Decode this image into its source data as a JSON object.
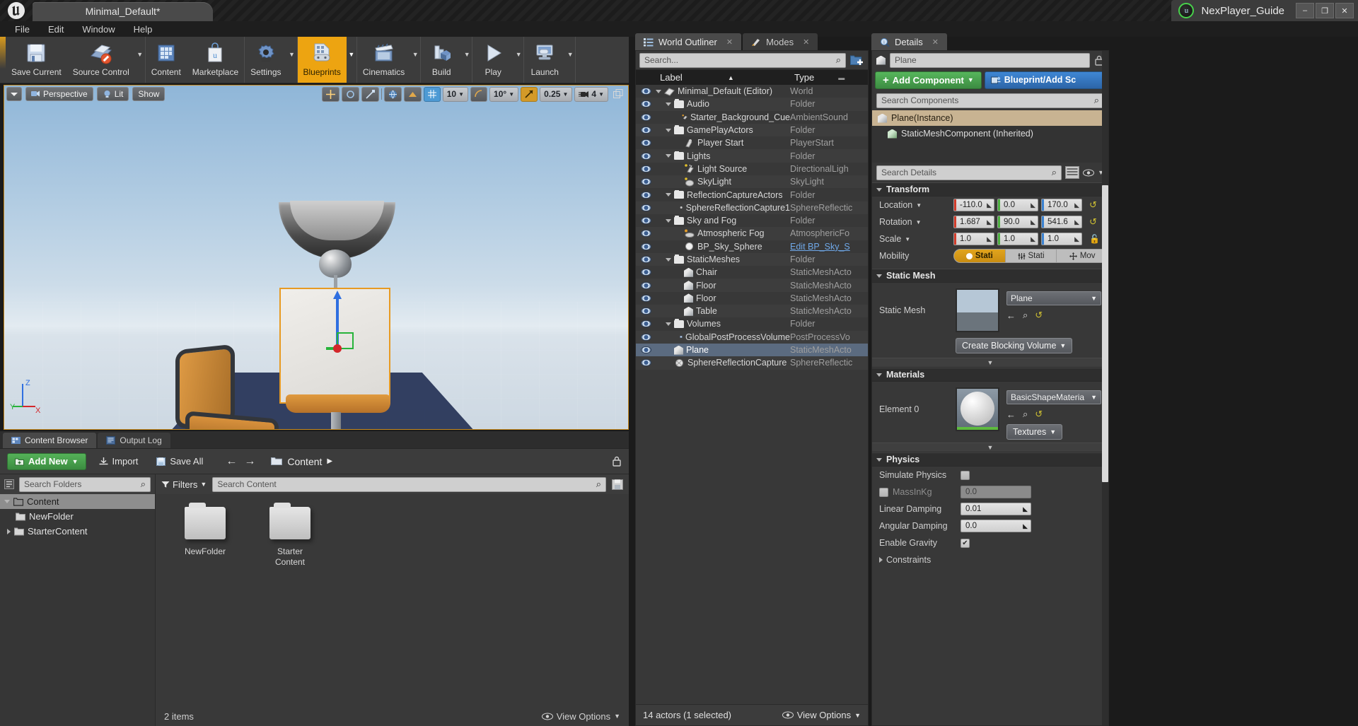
{
  "titlebar": {
    "logo": "unreal-logo",
    "document_tab": "Minimal_Default*",
    "project_name": "NexPlayer_Guide",
    "project_badge": "u",
    "window_buttons": {
      "minimize": "–",
      "maximize": "❐",
      "close": "✕"
    }
  },
  "menubar": {
    "items": [
      "File",
      "Edit",
      "Window",
      "Help"
    ]
  },
  "toolbar": {
    "buttons": [
      {
        "label": "Save Current",
        "icon": "save-icon",
        "caret": false,
        "active": false
      },
      {
        "label": "Source Control",
        "icon": "source-control-icon",
        "caret": true,
        "active": false
      },
      {
        "label": "Content",
        "icon": "content-icon",
        "caret": false,
        "active": false
      },
      {
        "label": "Marketplace",
        "icon": "marketplace-icon",
        "caret": false,
        "active": false
      },
      {
        "label": "Settings",
        "icon": "settings-gear-icon",
        "caret": true,
        "active": false
      },
      {
        "label": "Blueprints",
        "icon": "blueprints-icon",
        "caret": true,
        "active": true
      },
      {
        "label": "Cinematics",
        "icon": "cinematics-clapper-icon",
        "caret": true,
        "active": false
      },
      {
        "label": "Build",
        "icon": "build-icon",
        "caret": true,
        "active": false
      },
      {
        "label": "Play",
        "icon": "play-triangle-icon",
        "caret": true,
        "active": false
      },
      {
        "label": "Launch",
        "icon": "launch-icon",
        "caret": true,
        "active": false
      }
    ]
  },
  "viewport": {
    "left_controls": [
      {
        "label": "",
        "icon": "viewport-menu-icon"
      },
      {
        "label": "Perspective",
        "icon": "camera-icon"
      },
      {
        "label": "Lit",
        "icon": "lighting-icon"
      },
      {
        "label": "Show",
        "icon": ""
      }
    ],
    "right_controls": [
      {
        "name": "transform-translate-icon",
        "kind": "dark"
      },
      {
        "name": "transform-rotate-icon",
        "kind": "dark"
      },
      {
        "name": "transform-scale-icon",
        "kind": "dark"
      },
      {
        "name": "world-coords-icon",
        "kind": "dark"
      },
      {
        "name": "surface-snap-icon",
        "kind": "dark"
      },
      {
        "name": "grid-snap-icon",
        "kind": "grid",
        "value": "10"
      },
      {
        "name": "rotation-snap-icon",
        "kind": "dark",
        "value": "10°"
      },
      {
        "name": "scale-snap-icon",
        "kind": "highlight",
        "value": "0.25"
      },
      {
        "name": "camera-speed-icon",
        "kind": "dark",
        "value": "4"
      },
      {
        "name": "maximize-viewport-icon",
        "kind": "plain"
      }
    ],
    "axis_labels": {
      "x": "X",
      "y": "Y",
      "z": "Z"
    }
  },
  "world_outliner": {
    "tabs": [
      {
        "label": "World Outliner",
        "icon": "outliner-icon",
        "active": true
      },
      {
        "label": "Modes",
        "icon": "modes-icon",
        "active": false
      }
    ],
    "search_placeholder": "Search...",
    "add_icon": "add-folder-icon",
    "columns": {
      "label": "Label",
      "type": "Type"
    },
    "rows": [
      {
        "label": "Minimal_Default (Editor)",
        "type": "World",
        "indent": 0,
        "icon": "world-icon",
        "expander": "down",
        "selected": false
      },
      {
        "label": "Audio",
        "type": "Folder",
        "indent": 1,
        "icon": "folder-icon",
        "expander": "down",
        "selected": false
      },
      {
        "label": "Starter_Background_Cue",
        "type": "AmbientSound",
        "indent": 2,
        "icon": "ambient-sound-icon",
        "expander": "",
        "selected": false
      },
      {
        "label": "GamePlayActors",
        "type": "Folder",
        "indent": 1,
        "icon": "folder-icon",
        "expander": "down",
        "selected": false
      },
      {
        "label": "Player Start",
        "type": "PlayerStart",
        "indent": 2,
        "icon": "player-start-icon",
        "expander": "",
        "selected": false
      },
      {
        "label": "Lights",
        "type": "Folder",
        "indent": 1,
        "icon": "folder-icon",
        "expander": "down",
        "selected": false
      },
      {
        "label": "Light Source",
        "type": "DirectionalLigh",
        "indent": 2,
        "icon": "directional-light-icon",
        "expander": "",
        "selected": false
      },
      {
        "label": "SkyLight",
        "type": "SkyLight",
        "indent": 2,
        "icon": "sky-light-icon",
        "expander": "",
        "selected": false
      },
      {
        "label": "ReflectionCaptureActors",
        "type": "Folder",
        "indent": 1,
        "icon": "folder-icon",
        "expander": "down",
        "selected": false
      },
      {
        "label": "SphereReflectionCapture1",
        "type": "SphereReflectic",
        "indent": 2,
        "icon": "sphere-reflection-icon",
        "expander": "",
        "selected": false
      },
      {
        "label": "Sky and Fog",
        "type": "Folder",
        "indent": 1,
        "icon": "folder-icon",
        "expander": "down",
        "selected": false
      },
      {
        "label": "Atmospheric Fog",
        "type": "AtmosphericFo",
        "indent": 2,
        "icon": "atmospheric-fog-icon",
        "expander": "",
        "selected": false
      },
      {
        "label": "BP_Sky_Sphere",
        "type": "Edit BP_Sky_S",
        "type_is_link": true,
        "indent": 2,
        "icon": "sky-sphere-icon",
        "expander": "",
        "selected": false
      },
      {
        "label": "StaticMeshes",
        "type": "Folder",
        "indent": 1,
        "icon": "folder-icon",
        "expander": "down",
        "selected": false
      },
      {
        "label": "Chair",
        "type": "StaticMeshActo",
        "indent": 2,
        "icon": "static-mesh-icon",
        "expander": "",
        "selected": false
      },
      {
        "label": "Floor",
        "type": "StaticMeshActo",
        "indent": 2,
        "icon": "static-mesh-icon",
        "expander": "",
        "selected": false
      },
      {
        "label": "Floor",
        "type": "StaticMeshActo",
        "indent": 2,
        "icon": "static-mesh-icon",
        "expander": "",
        "selected": false
      },
      {
        "label": "Table",
        "type": "StaticMeshActo",
        "indent": 2,
        "icon": "static-mesh-icon",
        "expander": "",
        "selected": false
      },
      {
        "label": "Volumes",
        "type": "Folder",
        "indent": 1,
        "icon": "folder-icon",
        "expander": "down",
        "selected": false
      },
      {
        "label": "GlobalPostProcessVolume",
        "type": "PostProcessVo",
        "indent": 2,
        "icon": "post-process-icon",
        "expander": "",
        "selected": false
      },
      {
        "label": "Plane",
        "type": "StaticMeshActo",
        "indent": 1,
        "icon": "static-mesh-icon",
        "expander": "",
        "selected": true
      },
      {
        "label": "SphereReflectionCapture",
        "type": "SphereReflectic",
        "indent": 1,
        "icon": "sphere-reflection-icon",
        "expander": "",
        "selected": false
      }
    ],
    "status": "14 actors (1 selected)",
    "view_options": "View Options"
  },
  "details": {
    "tab": {
      "label": "Details",
      "icon": "details-magnifier-icon"
    },
    "lock_icon": "lock-icon",
    "actor_name": "Plane",
    "actor_icon": "static-mesh-icon",
    "add_component_label": "Add Component",
    "blueprint_label": "Blueprint/Add Sc",
    "search_components_placeholder": "Search Components",
    "components": [
      {
        "label": "Plane(Instance)",
        "icon": "static-mesh-icon",
        "highlighted": true,
        "child": false
      },
      {
        "label": "StaticMeshComponent (Inherited)",
        "icon": "static-mesh-green-icon",
        "highlighted": false,
        "child": true
      }
    ],
    "search_details_placeholder": "Search Details",
    "sections": {
      "transform": {
        "title": "Transform",
        "rows": [
          {
            "label": "Location",
            "values": [
              "-110.0",
              "0.0",
              "170.0"
            ],
            "reset": true
          },
          {
            "label": "Rotation",
            "values": [
              "1.687",
              "90.0",
              "541.6"
            ],
            "reset": true
          },
          {
            "label": "Scale",
            "values": [
              "1.0",
              "1.0",
              "1.0"
            ],
            "reset": false,
            "lock": true
          }
        ],
        "mobility": {
          "label": "Mobility",
          "options": [
            "Stati",
            "Stati",
            "Mov"
          ],
          "selected": 0
        }
      },
      "static_mesh": {
        "title": "Static Mesh",
        "label": "Static Mesh",
        "value": "Plane",
        "thumb": "plane-thumbnail",
        "create_blocking_volume": "Create Blocking Volume"
      },
      "materials": {
        "title": "Materials",
        "element_label": "Element 0",
        "material_value": "BasicShapeMateria",
        "thumb": "sphere-material-thumbnail",
        "textures_label": "Textures"
      },
      "physics": {
        "title": "Physics",
        "rows": [
          {
            "label": "Simulate Physics",
            "type": "checkbox",
            "checked": false,
            "dim": false
          },
          {
            "label": "MassInKg",
            "type": "text",
            "value": "0.0",
            "disabled": true,
            "dim": true,
            "has_checkbox": true
          },
          {
            "label": "Linear Damping",
            "type": "spin",
            "value": "0.01",
            "dim": false
          },
          {
            "label": "Angular Damping",
            "type": "spin",
            "value": "0.0",
            "dim": false
          },
          {
            "label": "Enable Gravity",
            "type": "checkbox",
            "checked": true,
            "dim": false
          },
          {
            "label": "Constraints",
            "type": "expander",
            "dim": false
          }
        ]
      }
    }
  },
  "content_browser": {
    "tabs": [
      {
        "label": "Content Browser",
        "icon": "content-browser-icon",
        "active": true
      },
      {
        "label": "Output Log",
        "icon": "output-log-icon",
        "active": false
      }
    ],
    "add_new_label": "Add New",
    "import_label": "Import",
    "save_all_label": "Save All",
    "breadcrumb_root": "Content",
    "search_folders_placeholder": "Search Folders",
    "search_content_placeholder": "Search Content",
    "filters_label": "Filters",
    "folder_tree": [
      {
        "label": "Content",
        "indent": 0,
        "selected": true,
        "expander": "down"
      },
      {
        "label": "NewFolder",
        "indent": 1,
        "selected": false,
        "expander": ""
      },
      {
        "label": "StarterContent",
        "indent": 1,
        "selected": false,
        "expander": "right"
      }
    ],
    "assets": [
      {
        "name": "NewFolder",
        "icon": "folder-icon"
      },
      {
        "name": "Starter\nContent",
        "icon": "folder-icon"
      }
    ],
    "status": "2 items",
    "view_options": "View Options"
  },
  "colors": {
    "accent_orange": "#eda411",
    "green_button": "#57b65c",
    "blue_button": "#3f87d4",
    "selection_blue": "#5b6b80",
    "panel_bg": "#383838",
    "toolbar_bg": "#3c3c3c"
  }
}
